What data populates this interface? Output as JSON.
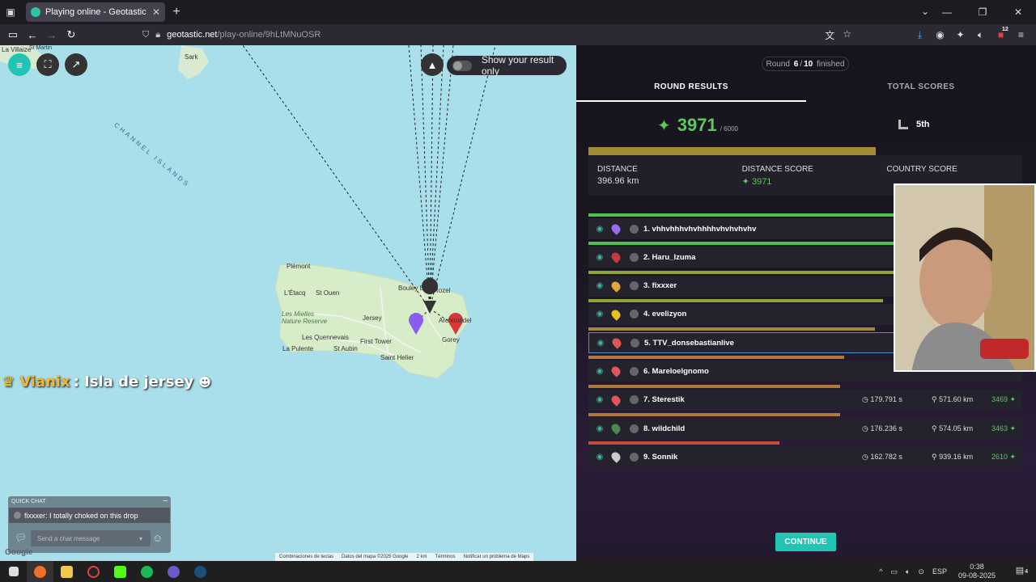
{
  "browser": {
    "tab_title": "Playing online - Geotastic",
    "url_host": "geotastic.net",
    "url_path": "/play-online/9hLtMNuOSR",
    "addon_badge": "12"
  },
  "map": {
    "toggle_label": "Show your result only",
    "labels": {
      "sark": "Sark",
      "la_villaize": "La Villaize",
      "st_martin": "St Martin",
      "channel_islands": "CHANNEL ISLANDS",
      "plemont": "Plémont",
      "etacq": "L'Étacq",
      "st_ouen": "St Ouen",
      "les_mielles": "Les Mielles Nature Reserve",
      "jersey": "Jersey",
      "bouley_bay": "Bouley Bay",
      "rozel": "Rozel",
      "les_quennevais": "Les Quennevais",
      "la_pulente": "La Pulente",
      "st_aubin": "St Aubin",
      "first_tower": "First Tower",
      "saint_helier": "Saint Helier",
      "gorey": "Gorey",
      "archirondel": "Archirondel"
    },
    "chat_overlay": {
      "user": "Vianix",
      "text": ": Isla de jersey"
    },
    "quick_chat": {
      "title": "QUICK CHAT",
      "message": "fixxxer: I totally choked on this drop",
      "placeholder": "Send a chat message"
    },
    "footer": {
      "shortcuts": "Combinaciones de teclas",
      "data": "Datos del mapa ©2025 Google",
      "scale": "2 km",
      "terms": "Términos",
      "report": "Notificar un problema de Maps"
    },
    "google": "Google"
  },
  "results": {
    "round_label": "Round",
    "round_current": "6",
    "round_sep": "/",
    "round_total": "10",
    "round_suffix": "finished",
    "tabs": [
      "ROUND RESULTS",
      "TOTAL SCORES"
    ],
    "score": "3971",
    "score_max": "/ 6000",
    "rank": "5th",
    "stats": [
      {
        "label": "DISTANCE",
        "value": "396.96 km"
      },
      {
        "label": "DISTANCE SCORE",
        "value": "3971"
      },
      {
        "label": "COUNTRY SCORE",
        "value": ""
      }
    ],
    "players": [
      {
        "rank": "1.",
        "name": "vhhvhhhvhvhhhhvhvhvhvhv",
        "time": "",
        "dist": "",
        "pts": "",
        "bar": 0.97,
        "bar_color": "#4cc24a",
        "pin": "#9b6cf0"
      },
      {
        "rank": "2.",
        "name": "Haru_Izuma",
        "time": "",
        "dist": "",
        "pts": "",
        "bar": 0.97,
        "bar_color": "#4cc24a",
        "pin": "#c53a3a"
      },
      {
        "rank": "3.",
        "name": "fixxxer",
        "time": "",
        "dist": "",
        "pts": "",
        "bar": 0.8,
        "bar_color": "#8ea53a",
        "pin": "#e0a63a"
      },
      {
        "rank": "4.",
        "name": "evelizyon",
        "time": "",
        "dist": "",
        "pts": "",
        "bar": 0.68,
        "bar_color": "#8ea53a",
        "pin": "#e8c020"
      },
      {
        "rank": "5.",
        "name": "TTV_donsebastianlive",
        "time": "",
        "dist": "",
        "pts": "",
        "bar": 0.66,
        "bar_color": "#a08a34",
        "pin": "#e05555"
      },
      {
        "rank": "6.",
        "name": "Mareloelgnomo",
        "time": "",
        "dist": "",
        "pts": "",
        "bar": 0.59,
        "bar_color": "#b07a3a",
        "pin": "#e05555"
      },
      {
        "rank": "7.",
        "name": "Sterestik",
        "time": "179.791 s",
        "dist": "571.60 km",
        "pts": "3469",
        "bar": 0.58,
        "bar_color": "#b07a3a",
        "pin": "#e05555"
      },
      {
        "rank": "8.",
        "name": "wildchild",
        "time": "176.236 s",
        "dist": "574.05 km",
        "pts": "3463",
        "bar": 0.58,
        "bar_color": "#b07a3a",
        "pin": "#4a8a4a"
      },
      {
        "rank": "9.",
        "name": "Sonnik",
        "time": "162.782 s",
        "dist": "939.16 km",
        "pts": "2610",
        "bar": 0.44,
        "bar_color": "#c0503a",
        "pin": "#cccccc"
      }
    ],
    "continue": "CONTINUE"
  },
  "taskbar": {
    "lang": "ESP",
    "time": "0:38",
    "date": "09-08-2025",
    "notif_count": "4"
  }
}
